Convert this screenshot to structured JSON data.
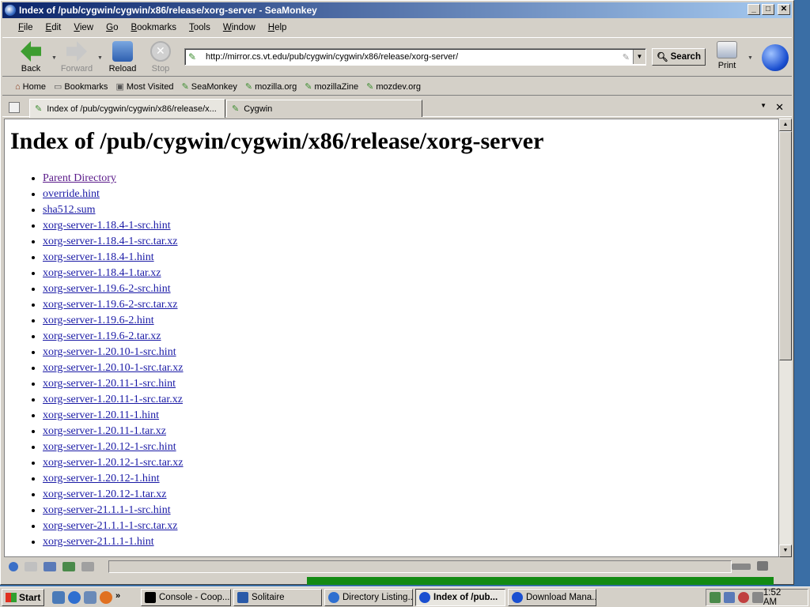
{
  "window": {
    "title": "Index of /pub/cygwin/cygwin/x86/release/xorg-server - SeaMonkey",
    "minimize": "_",
    "maximize": "□",
    "close": "✕"
  },
  "menu": [
    "File",
    "Edit",
    "View",
    "Go",
    "Bookmarks",
    "Tools",
    "Window",
    "Help"
  ],
  "nav": {
    "back": "Back",
    "forward": "Forward",
    "reload": "Reload",
    "stop": "Stop",
    "url": "http://mirror.cs.vt.edu/pub/cygwin/cygwin/x86/release/xorg-server/",
    "search": "Search",
    "print": "Print"
  },
  "bookmarks": [
    "Home",
    "Bookmarks",
    "Most Visited",
    "SeaMonkey",
    "mozilla.org",
    "mozillaZine",
    "mozdev.org"
  ],
  "tabs": [
    {
      "label": "Index of /pub/cygwin/cygwin/x86/release/x..."
    },
    {
      "label": "Cygwin"
    }
  ],
  "page": {
    "heading": "Index of /pub/cygwin/cygwin/x86/release/xorg-server",
    "files": [
      "Parent Directory",
      "override.hint",
      "sha512.sum",
      "xorg-server-1.18.4-1-src.hint",
      "xorg-server-1.18.4-1-src.tar.xz",
      "xorg-server-1.18.4-1.hint",
      "xorg-server-1.18.4-1.tar.xz",
      "xorg-server-1.19.6-2-src.hint",
      "xorg-server-1.19.6-2-src.tar.xz",
      "xorg-server-1.19.6-2.hint",
      "xorg-server-1.19.6-2.tar.xz",
      "xorg-server-1.20.10-1-src.hint",
      "xorg-server-1.20.10-1-src.tar.xz",
      "xorg-server-1.20.11-1-src.hint",
      "xorg-server-1.20.11-1-src.tar.xz",
      "xorg-server-1.20.11-1.hint",
      "xorg-server-1.20.11-1.tar.xz",
      "xorg-server-1.20.12-1-src.hint",
      "xorg-server-1.20.12-1-src.tar.xz",
      "xorg-server-1.20.12-1.hint",
      "xorg-server-1.20.12-1.tar.xz",
      "xorg-server-21.1.1-1-src.hint",
      "xorg-server-21.1.1-1-src.tar.xz",
      "xorg-server-21.1.1-1.hint"
    ]
  },
  "taskbar": {
    "start": "Start",
    "tasks": [
      "Console - Coop...",
      "Solitaire",
      "Directory Listing...",
      "Index of /pub...",
      "Download Mana..."
    ],
    "clock": "1:52 AM"
  },
  "colors": {
    "titlebar": "#0a246a",
    "link": "#1a1aa6",
    "visited_link": "#5a1a8a",
    "desktop": "#3a6ea5"
  }
}
